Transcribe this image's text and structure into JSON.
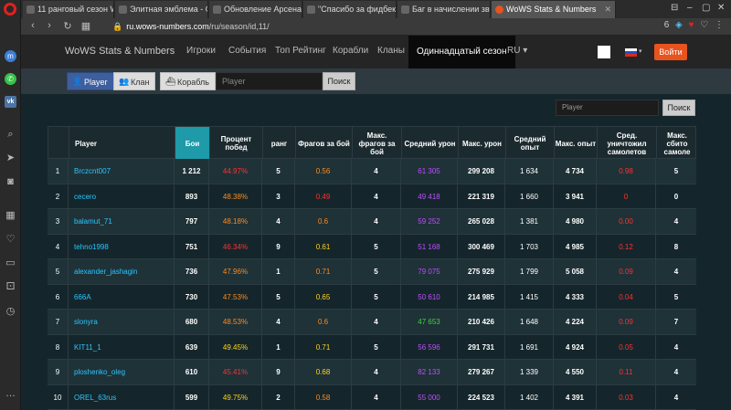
{
  "browser": {
    "tabs": [
      {
        "title": "11 ранговый сезон Wo",
        "active": false
      },
      {
        "title": "Элитная эмблема - Стра",
        "active": false
      },
      {
        "title": "Обновление Арсенала.",
        "active": false
      },
      {
        "title": "\"Спасибо за фидбек, пе",
        "active": false
      },
      {
        "title": "Баг в начислении звезд",
        "active": false
      },
      {
        "title": "WoWS Stats & Numbers",
        "active": true
      }
    ],
    "url_domain": "ru.wows-numbers.com",
    "url_path": "/ru/season/id,11/",
    "badge": "6"
  },
  "nav": {
    "brand": "WoWS Stats & Numbers",
    "links": [
      "Игроки",
      "События",
      "Топ Рейтинг",
      "Корабли",
      "Кланы",
      "Одиннадцатый сезон",
      "RU ▾"
    ],
    "active_index": 5,
    "login": "Войти"
  },
  "search": {
    "toggles": [
      "Player",
      "Клан",
      "Корабль"
    ],
    "placeholder": "Player",
    "button": "Поиск"
  },
  "table_search": {
    "placeholder": "Player",
    "button": "Поиск"
  },
  "table": {
    "headers": [
      "",
      "Player",
      "Бои",
      "Процент побед",
      "ранг",
      "Фрагов за бой",
      "Макс. фрагов за бой",
      "Средний урон",
      "Макс. урон",
      "Средний опыт",
      "Макс. опыт",
      "Сред. уничтожил самолетов",
      "Макс. сбито самоле"
    ],
    "rows": [
      {
        "n": "1",
        "player": "Brczcnt007",
        "battles": "1 212",
        "wr": "44.97%",
        "wr_c": "red",
        "rank": "5",
        "frags": "0.56",
        "frags_c": "orange",
        "maxfrags": "4",
        "avgdmg": "61 305",
        "avgdmg_c": "purple",
        "maxdmg": "299 208",
        "avgxp": "1 634",
        "maxxp": "4 734",
        "planes": "0.98",
        "planes_c": "red",
        "maxplanes": "5"
      },
      {
        "n": "2",
        "player": "cecero",
        "battles": "893",
        "wr": "48.38%",
        "wr_c": "orange",
        "rank": "3",
        "frags": "0.49",
        "frags_c": "red",
        "maxfrags": "4",
        "avgdmg": "49 418",
        "avgdmg_c": "purple",
        "maxdmg": "221 319",
        "avgxp": "1 660",
        "maxxp": "3 941",
        "planes": "0",
        "planes_c": "red",
        "maxplanes": "0"
      },
      {
        "n": "3",
        "player": "balamut_71",
        "battles": "797",
        "wr": "48.18%",
        "wr_c": "orange",
        "rank": "4",
        "frags": "0.6",
        "frags_c": "orange",
        "maxfrags": "4",
        "avgdmg": "59 252",
        "avgdmg_c": "purple",
        "maxdmg": "265 028",
        "avgxp": "1 381",
        "maxxp": "4 980",
        "planes": "0.00",
        "planes_c": "red",
        "maxplanes": "4"
      },
      {
        "n": "4",
        "player": "tehno1998",
        "battles": "751",
        "wr": "46.34%",
        "wr_c": "red",
        "rank": "9",
        "frags": "0.61",
        "frags_c": "yellow",
        "maxfrags": "5",
        "avgdmg": "51 168",
        "avgdmg_c": "purple",
        "maxdmg": "300 469",
        "avgxp": "1 703",
        "maxxp": "4 985",
        "planes": "0.12",
        "planes_c": "red",
        "maxplanes": "8"
      },
      {
        "n": "5",
        "player": "alexander_jashagin",
        "battles": "736",
        "wr": "47.96%",
        "wr_c": "orange",
        "rank": "1",
        "frags": "0.71",
        "frags_c": "orange",
        "maxfrags": "5",
        "avgdmg": "79 075",
        "avgdmg_c": "purple",
        "maxdmg": "275 929",
        "avgxp": "1 799",
        "maxxp": "5 058",
        "planes": "0.09",
        "planes_c": "red",
        "maxplanes": "4"
      },
      {
        "n": "6",
        "player": "666A",
        "battles": "730",
        "wr": "47.53%",
        "wr_c": "orange",
        "rank": "5",
        "frags": "0.65",
        "frags_c": "yellow",
        "maxfrags": "5",
        "avgdmg": "50 610",
        "avgdmg_c": "purple",
        "maxdmg": "214 985",
        "avgxp": "1 415",
        "maxxp": "4 333",
        "planes": "0.04",
        "planes_c": "red",
        "maxplanes": "5"
      },
      {
        "n": "7",
        "player": "slonyra",
        "battles": "680",
        "wr": "48.53%",
        "wr_c": "orange",
        "rank": "4",
        "frags": "0.6",
        "frags_c": "orange",
        "maxfrags": "4",
        "avgdmg": "47 653",
        "avgdmg_c": "green",
        "maxdmg": "210 426",
        "avgxp": "1 648",
        "maxxp": "4 224",
        "planes": "0.09",
        "planes_c": "red",
        "maxplanes": "7"
      },
      {
        "n": "8",
        "player": "KIT11_1",
        "battles": "639",
        "wr": "49.45%",
        "wr_c": "yellow",
        "rank": "1",
        "frags": "0.71",
        "frags_c": "yellow",
        "maxfrags": "5",
        "avgdmg": "56 596",
        "avgdmg_c": "purple",
        "maxdmg": "291 731",
        "avgxp": "1 691",
        "maxxp": "4 924",
        "planes": "0.05",
        "planes_c": "red",
        "maxplanes": "4"
      },
      {
        "n": "9",
        "player": "ploshenko_oleg",
        "battles": "610",
        "wr": "45.41%",
        "wr_c": "red",
        "rank": "9",
        "frags": "0.68",
        "frags_c": "yellow",
        "maxfrags": "4",
        "avgdmg": "82 133",
        "avgdmg_c": "purple",
        "maxdmg": "279 267",
        "avgxp": "1 339",
        "maxxp": "4 550",
        "planes": "0.11",
        "planes_c": "red",
        "maxplanes": "4"
      },
      {
        "n": "10",
        "player": "OREL_63rus",
        "battles": "599",
        "wr": "49.75%",
        "wr_c": "yellow",
        "rank": "2",
        "frags": "0.58",
        "frags_c": "orange",
        "maxfrags": "4",
        "avgdmg": "55 000",
        "avgdmg_c": "purple",
        "maxdmg": "224 523",
        "avgxp": "1 402",
        "maxxp": "4 391",
        "planes": "0.03",
        "planes_c": "red",
        "maxplanes": "4"
      }
    ]
  },
  "colors": {
    "accent_sorted": "#1e9aa8",
    "login": "#e8531e",
    "active_toggle": "#3d5f9e"
  }
}
